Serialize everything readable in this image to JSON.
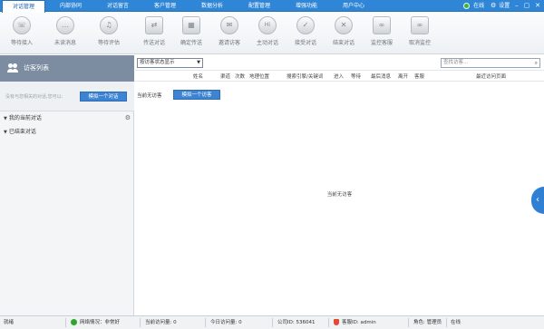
{
  "topbar": {
    "tabs": [
      "对话管理",
      "内部协同",
      "对话留言",
      "客户管理",
      "数据分析",
      "配置管理",
      "增强功能",
      "用户中心"
    ],
    "active_tab": 0,
    "status_text": "在线",
    "settings_label": "设置"
  },
  "toolbar": {
    "buttons": [
      {
        "label": "等待接入",
        "icon": "phone-icon"
      },
      {
        "label": "未读消息",
        "icon": "chat-bubble-icon"
      },
      {
        "label": "等待评估",
        "icon": "bell-icon"
      },
      {
        "label": "传送对话",
        "icon": "transfer-icon"
      },
      {
        "label": "确定传送",
        "icon": "calendar-icon"
      },
      {
        "label": "邀请访客",
        "icon": "invite-icon"
      },
      {
        "label": "主动对话",
        "icon": "hi-icon"
      },
      {
        "label": "接受对话",
        "icon": "accept-icon"
      },
      {
        "label": "结束对话",
        "icon": "close-icon"
      },
      {
        "label": "监控客服",
        "icon": "binoculars-icon"
      },
      {
        "label": "取消监控",
        "icon": "unmonitor-icon"
      }
    ]
  },
  "leftpanel": {
    "title": "访客列表",
    "invite_hint": "没有与您相关的对话,您可以:",
    "invite_button": "模拟一个对话",
    "sections": [
      "我的当前对话",
      "已结束对话"
    ]
  },
  "main": {
    "filter_select": "按访客状态显示",
    "search_placeholder": "查找访客...",
    "columns": [
      "姓名",
      "渠道",
      "次数",
      "地理位置",
      "搜索引擎/关键词",
      "进入",
      "等待",
      "最后消息",
      "离开",
      "客服",
      "最近访问页面"
    ],
    "no_visitor_text": "当前无访客",
    "invite_button": "模拟一个访客",
    "empty_text": "当前无访客"
  },
  "statusbar": {
    "ready": "就绪",
    "network": "网络情况：非常好",
    "current_visits": "当前访问量: 0",
    "today_visits": "今日访问量: 0",
    "company_id": "公司ID: 536041",
    "agent_id": "客服ID: admin",
    "role": "角色: 管理员",
    "status": "在线"
  }
}
